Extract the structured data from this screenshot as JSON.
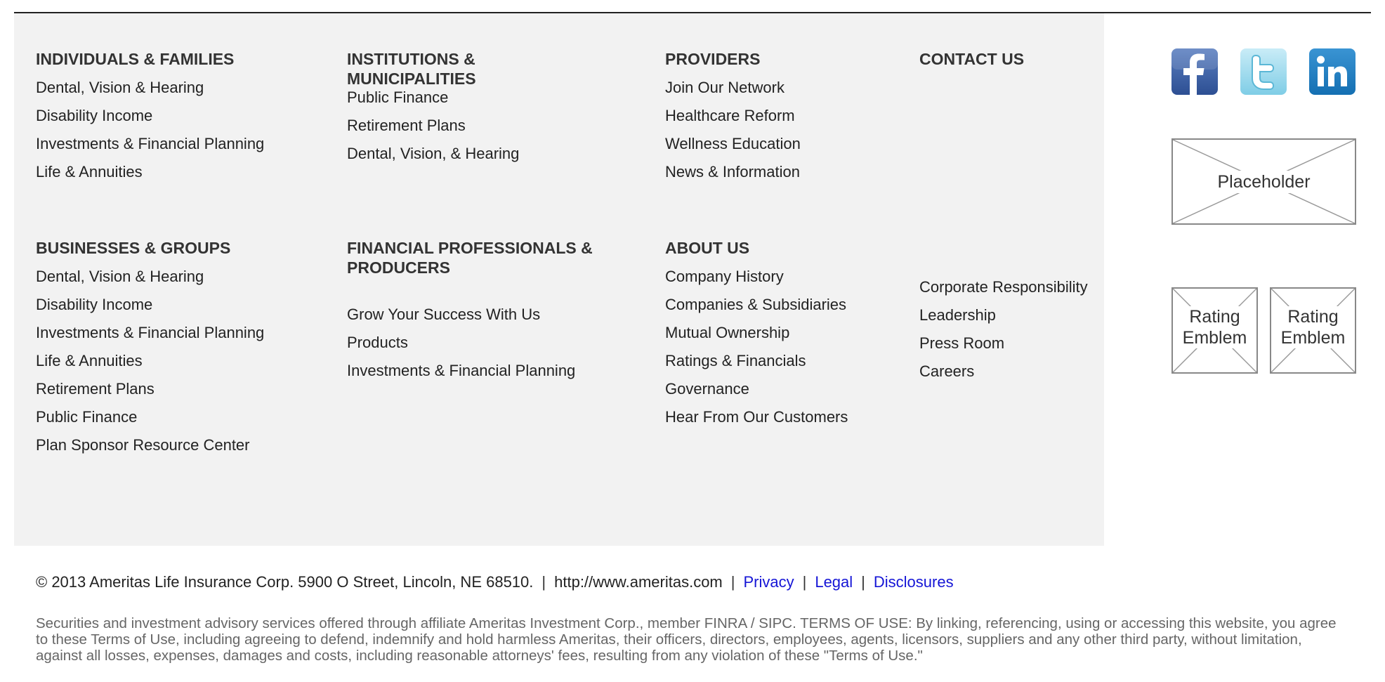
{
  "sections": {
    "individuals": {
      "heading": "INDIVIDUALS & FAMILIES",
      "links": [
        "Dental, Vision & Hearing",
        "Disability Income",
        "Investments & Financial Planning",
        "Life & Annuities"
      ]
    },
    "institutions": {
      "heading_line1": "INSTITUTIONS &",
      "heading_line2": "MUNICIPALITIES",
      "links": [
        "Public Finance",
        "Retirement Plans",
        "Dental, Vision, & Hearing"
      ]
    },
    "providers": {
      "heading": "PROVIDERS",
      "links": [
        "Join Our Network",
        "Healthcare Reform",
        "Wellness Education",
        "News & Information"
      ]
    },
    "contact": {
      "heading": "CONTACT US"
    },
    "businesses": {
      "heading": "BUSINESSES & GROUPS",
      "links": [
        "Dental, Vision & Hearing",
        "Disability Income",
        "Investments & Financial Planning",
        "Life & Annuities",
        "Retirement Plans",
        "Public Finance",
        "Plan Sponsor Resource Center"
      ]
    },
    "financial": {
      "heading_line1": "FINANCIAL PROFESSIONALS &",
      "heading_line2": "PRODUCERS",
      "links": [
        "Grow Your  Success With Us",
        "Products",
        "Investments & Financial Planning"
      ]
    },
    "about": {
      "heading": "ABOUT US",
      "links": [
        "Company History",
        "Companies & Subsidiaries",
        "Mutual Ownership",
        "Ratings & Financials",
        "Governance",
        "Hear From Our Customers"
      ]
    },
    "about_more": {
      "links": [
        "Corporate Responsibility",
        "Leadership",
        "Press Room",
        "Careers"
      ]
    }
  },
  "side": {
    "social_icons": [
      "facebook-icon",
      "twitter-icon",
      "linkedin-icon"
    ],
    "placeholder_label": "Placeholder",
    "emblem1_line1": "Rating",
    "emblem1_line2": "Emblem",
    "emblem2_line1": "Rating",
    "emblem2_line2": "Emblem"
  },
  "footer": {
    "copyright": "© 2013 Ameritas Life Insurance Corp. 5900 O Street, Lincoln, NE  68510.",
    "sep": "|",
    "url": "http://www.ameritas.com",
    "privacy": "Privacy",
    "legal": "Legal",
    "disclosures": "Disclosures",
    "disclaimer": "Securities and investment advisory services offered through affiliate Ameritas Investment Corp., member FINRA / SIPC. TERMS OF USE: By linking, referencing, using or accessing this website, you agree to these Terms of Use, including agreeing to defend, indemnify and hold harmless Ameritas, their officers, directors, employees, agents, licensors, suppliers and any other third party, without limitation, against all losses, expenses, damages and costs, including reasonable attorneys' fees, resulting from any violation of these \"Terms of Use.\""
  },
  "colors": {
    "panel_bg": "#f2f2f2",
    "link_blue": "#1515d6",
    "heading": "#333333"
  }
}
